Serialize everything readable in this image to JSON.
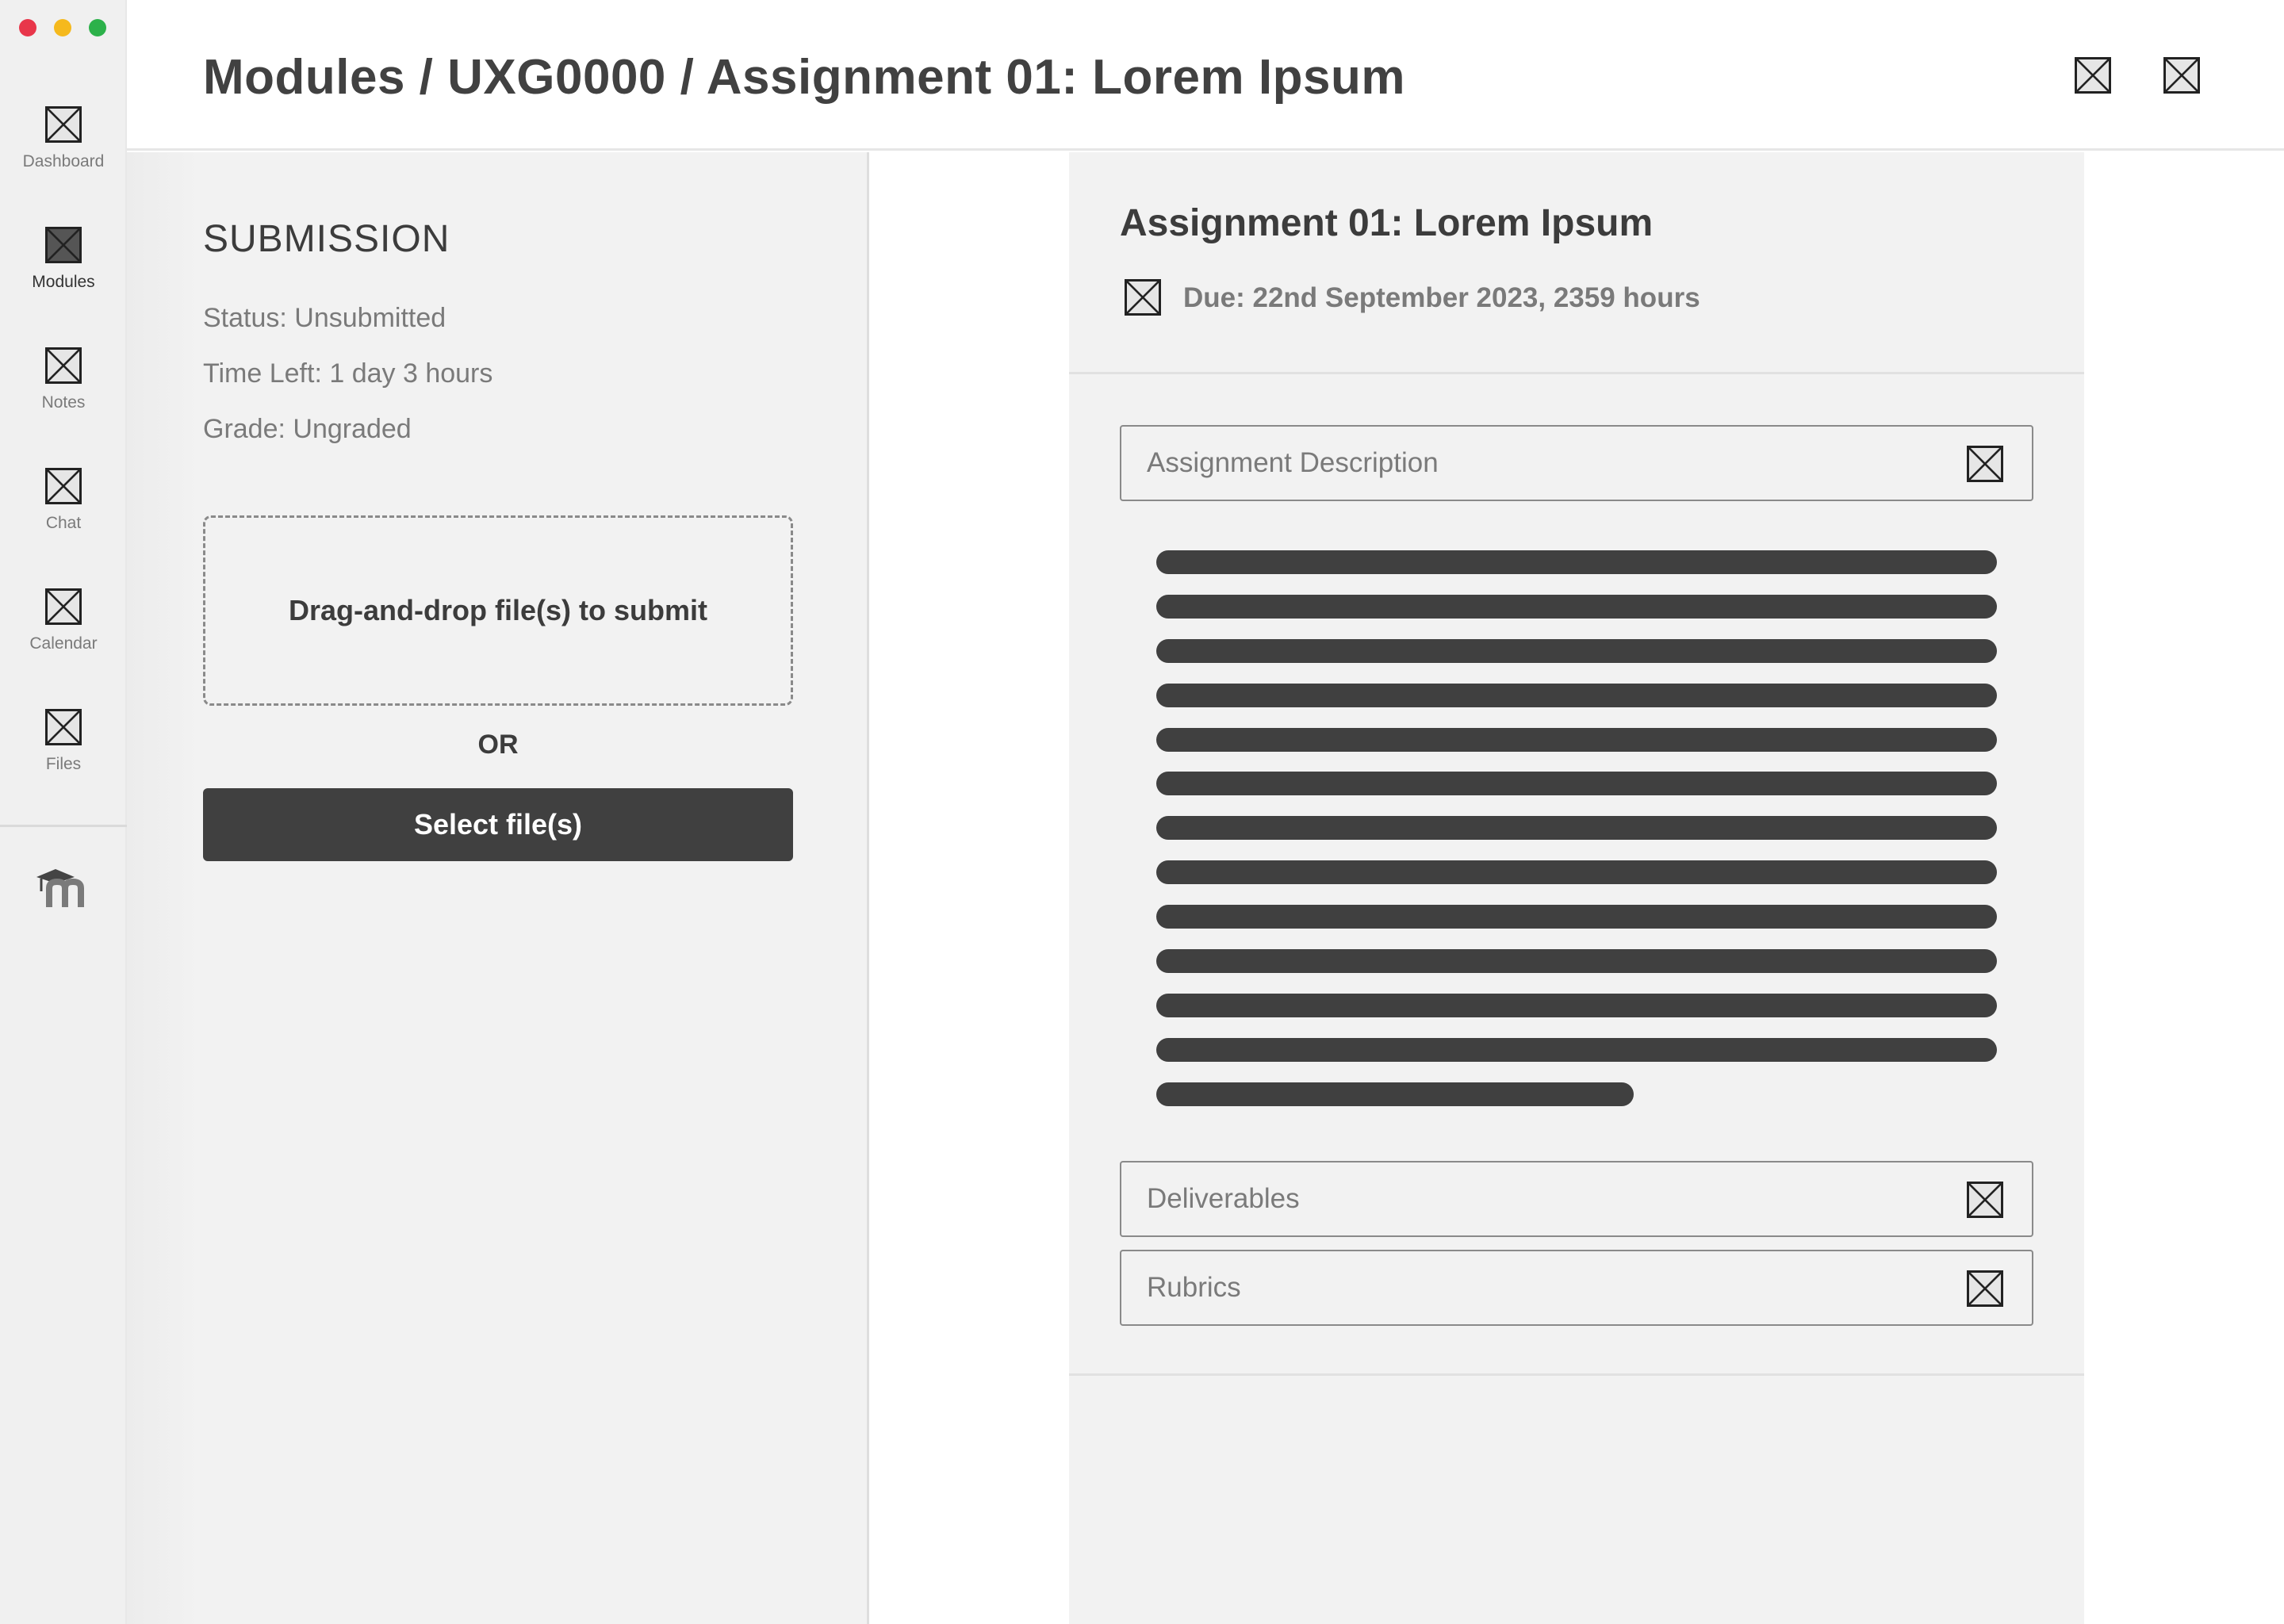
{
  "window": {
    "traffic_lights": {
      "close": "#e8364a",
      "minimize": "#f5b91d",
      "zoom": "#2cb14a"
    }
  },
  "nav": {
    "items": [
      {
        "label": "Dashboard",
        "icon": "placeholder-icon",
        "active": false
      },
      {
        "label": "Modules",
        "icon": "placeholder-icon",
        "active": true
      },
      {
        "label": "Notes",
        "icon": "placeholder-icon",
        "active": false
      },
      {
        "label": "Chat",
        "icon": "placeholder-icon",
        "active": false
      },
      {
        "label": "Calendar",
        "icon": "placeholder-icon",
        "active": false
      },
      {
        "label": "Files",
        "icon": "placeholder-icon",
        "active": false
      }
    ],
    "logo_icon": "moodle-logo-icon"
  },
  "header": {
    "breadcrumb": "Modules / UXG0000 / Assignment 01: Lorem Ipsum",
    "actions": [
      "placeholder-icon",
      "placeholder-icon"
    ]
  },
  "submission": {
    "title": "SUBMISSION",
    "status": "Status: Unsubmitted",
    "time_left": "Time Left: 1 day 3 hours",
    "grade": "Grade: Ungraded",
    "dropzone_label": "Drag-and-drop file(s) to submit",
    "or_label": "OR",
    "select_button": "Select file(s)"
  },
  "assignment": {
    "title": "Assignment 01: Lorem Ipsum",
    "due": "Due: 22nd September 2023, 2359 hours",
    "sections": {
      "description": "Assignment Description",
      "deliverables": "Deliverables",
      "rubrics": "Rubrics"
    }
  },
  "colors": {
    "accent_dark": "#404040",
    "panel_bg": "#f2f2f2",
    "muted_text": "#7a7a7a"
  }
}
